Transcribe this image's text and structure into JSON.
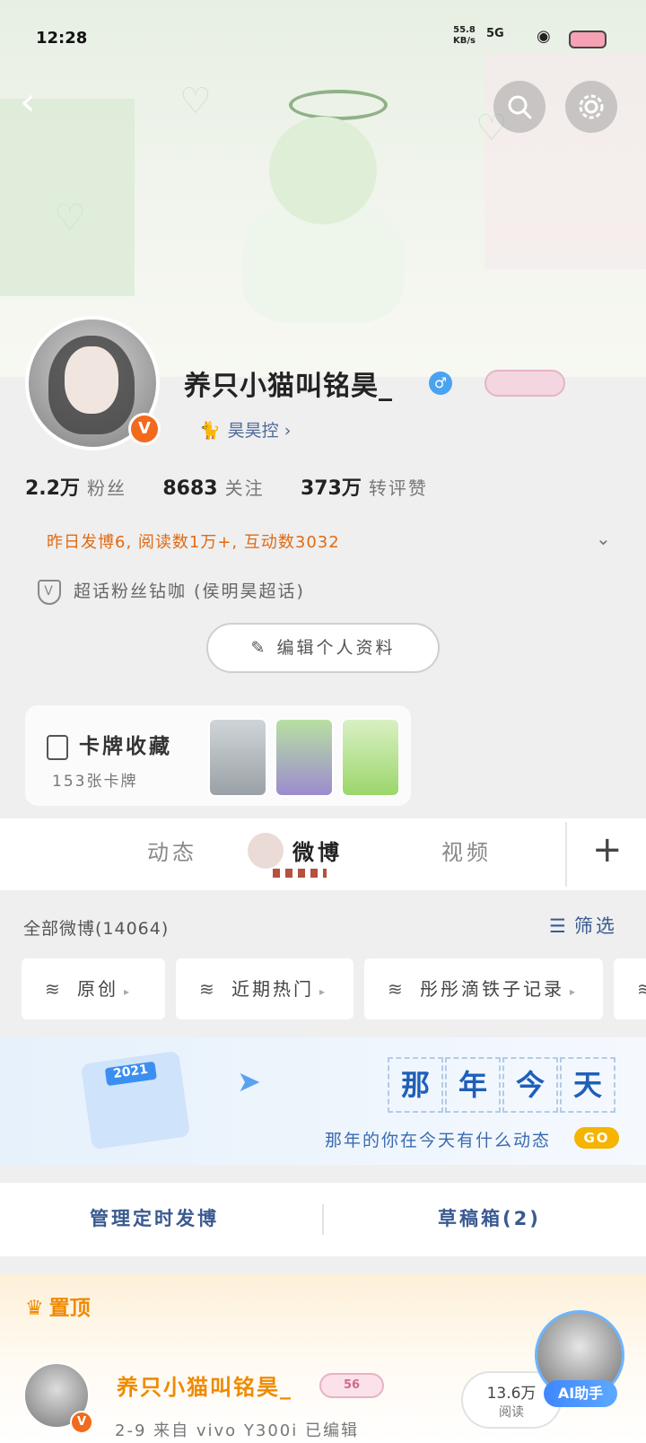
{
  "status_bar": {
    "time": "12:28",
    "net_speed": "55.8",
    "net_unit": "KB/s",
    "signal": "5G"
  },
  "profile": {
    "username": "养只小猫叫铭昊_",
    "gender_symbol": "♂",
    "fan_club": "昊昊控 ›",
    "verified_mark": "V"
  },
  "stats": [
    {
      "num": "2.2万",
      "label": "粉丝"
    },
    {
      "num": "8683",
      "label": "关注"
    },
    {
      "num": "373万",
      "label": "转评赞"
    }
  ],
  "activity_text": "昨日发博6, 阅读数1万+, 互动数3032",
  "supertopic_text": "超话粉丝钻咖 (侯明昊超话)",
  "edit_profile_label": "编辑个人资料",
  "card_collection": {
    "title": "卡牌收藏",
    "count": "153张卡牌"
  },
  "tabs": [
    {
      "label": "动态"
    },
    {
      "label": "微博"
    },
    {
      "label": "视频"
    }
  ],
  "filter": {
    "all_weibo": "全部微博(14064)",
    "filter_label": "筛选",
    "chips": [
      "原创",
      "近期热门",
      "彤彤滴铁子记录"
    ]
  },
  "that_year": {
    "calendar_year": "2021",
    "title_chars": [
      "那",
      "年",
      "今",
      "天"
    ],
    "subtitle": "那年的你在今天有什么动态",
    "go_label": "GO"
  },
  "manage": {
    "scheduled": "管理定时发博",
    "drafts": "草稿箱(2)"
  },
  "pinned": {
    "label": "置顶",
    "post_name": "养只小猫叫铭昊_",
    "post_tag": "56",
    "post_meta": "2-9  来自 vivo Y300i  已编辑",
    "read_value": "13.6万",
    "read_label": "阅读",
    "ai_label": "AI助手"
  },
  "colors": {
    "accent_orange": "#f08a00",
    "link_blue": "#3a5a90",
    "activity_orange": "#e06a16",
    "verified": "#f26a1c"
  }
}
